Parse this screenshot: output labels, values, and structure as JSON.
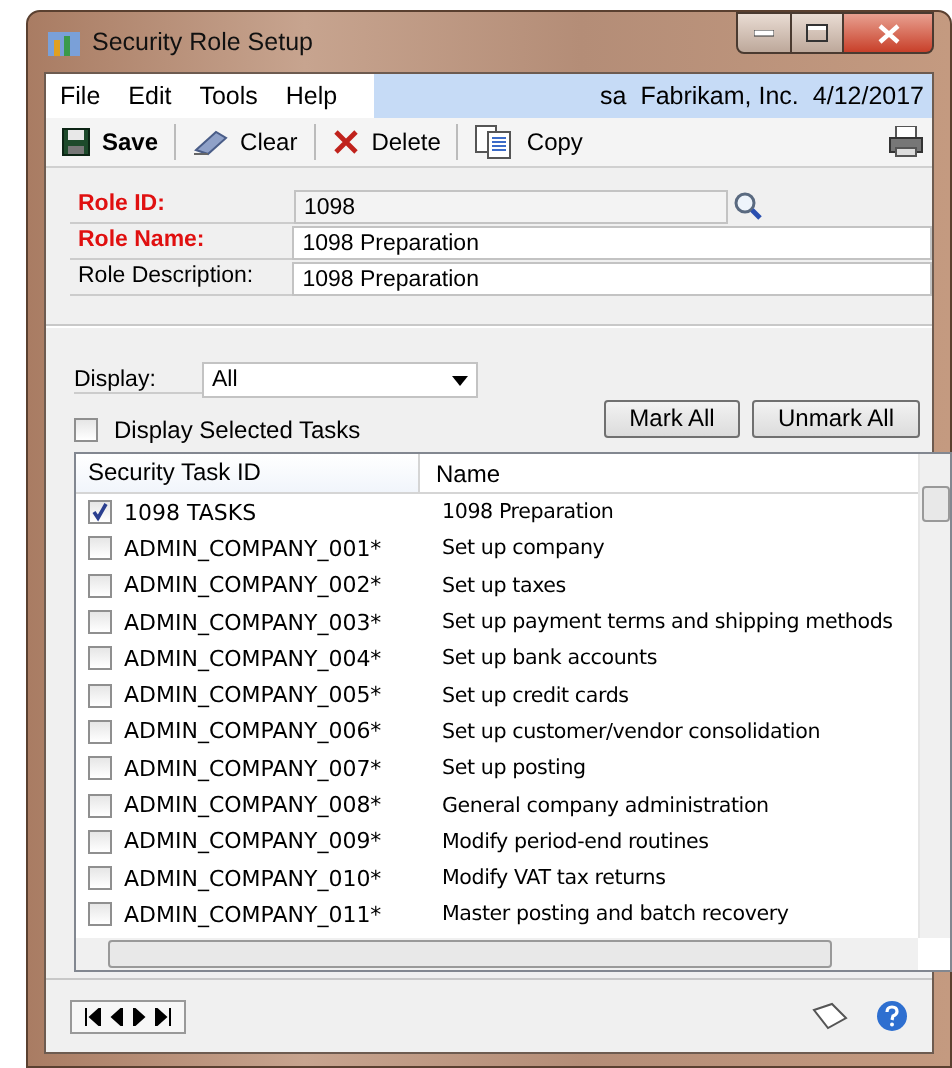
{
  "window": {
    "title": "Security Role Setup"
  },
  "menu": [
    "File",
    "Edit",
    "Tools",
    "Help"
  ],
  "session": [
    "sa",
    "Fabrikam, Inc.",
    "4/12/2017"
  ],
  "toolbar": [
    {
      "label": "Save",
      "kind": "save"
    },
    {
      "label": "Clear",
      "kind": "clear"
    },
    {
      "label": "Delete",
      "kind": "delete"
    },
    {
      "label": "Copy",
      "kind": "copy"
    }
  ],
  "fields": [
    {
      "label": "Role ID:",
      "value": "1098",
      "required": true,
      "lookup": true
    },
    {
      "label": "Role Name:",
      "value": "1098 Preparation",
      "required": true,
      "lookup": false
    },
    {
      "label": "Role Description:",
      "value": "1098 Preparation",
      "required": false,
      "lookup": false
    }
  ],
  "display": {
    "label": "Display:",
    "value": "All"
  },
  "display_selected": {
    "label": "Display Selected Tasks",
    "checked": false
  },
  "buttons": [
    "Mark All",
    "Unmark All"
  ],
  "table": {
    "columns": [
      "Security Task ID",
      "Name"
    ],
    "rows": [
      {
        "id": "1098 TASKS",
        "name": "1098 Preparation",
        "checked": true
      },
      {
        "id": "ADMIN_COMPANY_001*",
        "name": "Set up company",
        "checked": false
      },
      {
        "id": "ADMIN_COMPANY_002*",
        "name": "Set up taxes",
        "checked": false
      },
      {
        "id": "ADMIN_COMPANY_003*",
        "name": "Set up payment terms and shipping methods",
        "checked": false
      },
      {
        "id": "ADMIN_COMPANY_004*",
        "name": "Set up bank accounts",
        "checked": false
      },
      {
        "id": "ADMIN_COMPANY_005*",
        "name": "Set up credit cards",
        "checked": false
      },
      {
        "id": "ADMIN_COMPANY_006*",
        "name": "Set up customer/vendor consolidation",
        "checked": false
      },
      {
        "id": "ADMIN_COMPANY_007*",
        "name": "Set up posting",
        "checked": false
      },
      {
        "id": "ADMIN_COMPANY_008*",
        "name": "General company administration",
        "checked": false
      },
      {
        "id": "ADMIN_COMPANY_009*",
        "name": "Modify period-end routines",
        "checked": false
      },
      {
        "id": "ADMIN_COMPANY_010*",
        "name": "Modify VAT tax returns",
        "checked": false
      },
      {
        "id": "ADMIN_COMPANY_011*",
        "name": "Master posting and batch recovery",
        "checked": false
      }
    ]
  }
}
